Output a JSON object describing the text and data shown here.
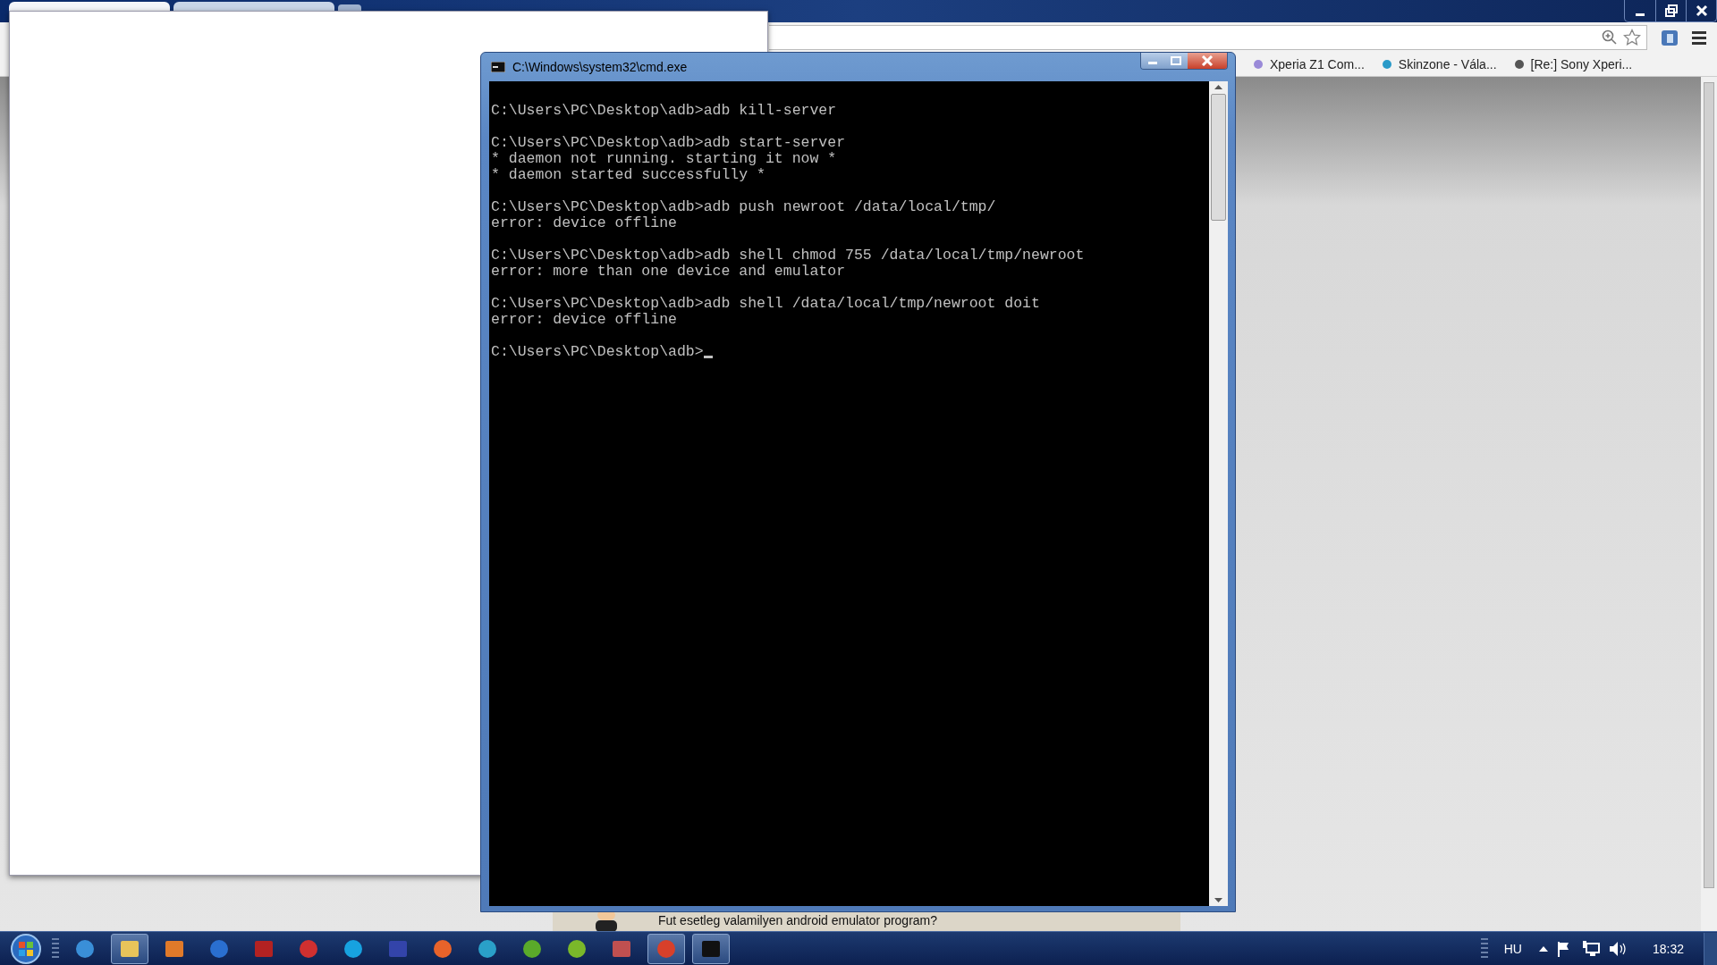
{
  "browser": {
    "tabs": [
      {
        "selected": true
      },
      {
        "selected": false
      }
    ],
    "bookmarks": [
      {
        "label": "Xperia Z1 Com..."
      },
      {
        "label": "Skinzone - Vála..."
      },
      {
        "label": "[Re:] Sony Xperi..."
      }
    ],
    "dialog_text": "Fut esetleg valamilyen android emulator program?"
  },
  "console": {
    "title": "C:\\Windows\\system32\\cmd.exe",
    "blocks": [
      [
        "C:\\Users\\PC\\Desktop\\adb>adb kill-server"
      ],
      [
        "C:\\Users\\PC\\Desktop\\adb>adb start-server",
        "* daemon not running. starting it now *",
        "* daemon started successfully *"
      ],
      [
        "C:\\Users\\PC\\Desktop\\adb>adb push newroot /data/local/tmp/",
        "error: device offline"
      ],
      [
        "C:\\Users\\PC\\Desktop\\adb>adb shell chmod 755 /data/local/tmp/newroot",
        "error: more than one device and emulator"
      ],
      [
        "C:\\Users\\PC\\Desktop\\adb>adb shell /data/local/tmp/newroot doit",
        "error: device offline"
      ],
      [
        "C:\\Users\\PC\\Desktop\\adb>"
      ]
    ],
    "cursor": true
  },
  "taskbar": {
    "items": [
      {
        "running": false
      },
      {
        "running": true
      },
      {
        "running": false
      },
      {
        "running": false
      },
      {
        "running": false
      },
      {
        "running": false
      },
      {
        "running": false
      },
      {
        "running": false
      },
      {
        "running": false
      },
      {
        "running": false
      },
      {
        "running": false
      },
      {
        "running": false
      },
      {
        "running": false
      },
      {
        "running": true
      },
      {
        "running": true
      }
    ],
    "language": "HU",
    "clock": "18:32"
  }
}
